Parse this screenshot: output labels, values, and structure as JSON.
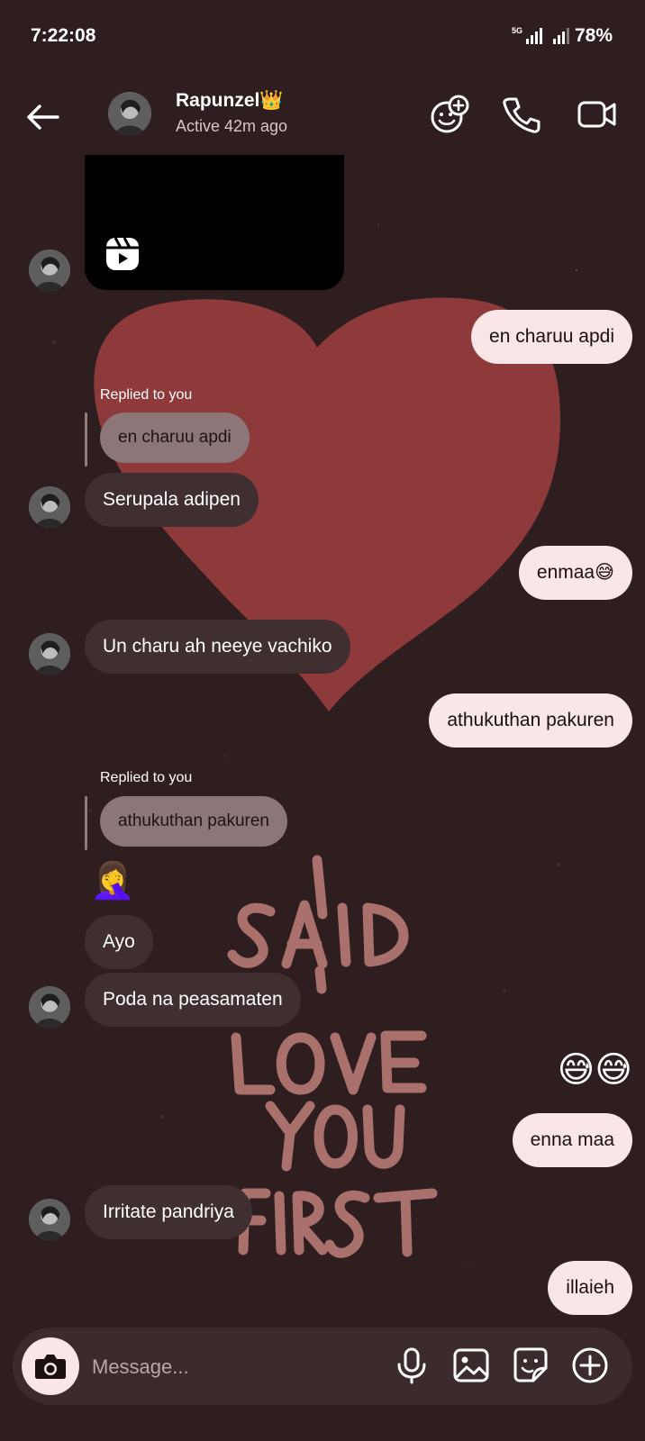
{
  "status_bar": {
    "time": "7:22:08",
    "battery": "78%",
    "network": "5G"
  },
  "header": {
    "contact_name": "Rapunzel👑",
    "contact_status": "Active 42m ago"
  },
  "messages": [
    {
      "dir": "out",
      "text": "en charuu apdi"
    },
    {
      "dir": "in",
      "reply_label": "Replied to you",
      "quoted": "en charuu apdi",
      "text": "Serupala adipen"
    },
    {
      "dir": "out",
      "text": "enmaa😅"
    },
    {
      "dir": "in",
      "text": "Un charu ah neeye vachiko"
    },
    {
      "dir": "out",
      "text": "athukuthan pakuren"
    },
    {
      "dir": "in",
      "reply_label": "Replied to you",
      "quoted": "athukuthan pakuren",
      "text": "🤦‍♀️"
    },
    {
      "dir": "in",
      "text": "Ayo"
    },
    {
      "dir": "in",
      "text": "Poda na peasamaten"
    },
    {
      "dir": "out",
      "text": "😅😅"
    },
    {
      "dir": "out",
      "text": "enna maa"
    },
    {
      "dir": "in",
      "text": "Irritate pandriya"
    },
    {
      "dir": "out",
      "text": "illaieh"
    }
  ],
  "composer": {
    "placeholder": "Message..."
  },
  "colors": {
    "background": "#2f1e20",
    "heart": "#8e3a3b",
    "incoming_bubble": "#3f2f30",
    "outgoing_bubble": "#fbe6e7",
    "art_text": "#a9706c"
  }
}
